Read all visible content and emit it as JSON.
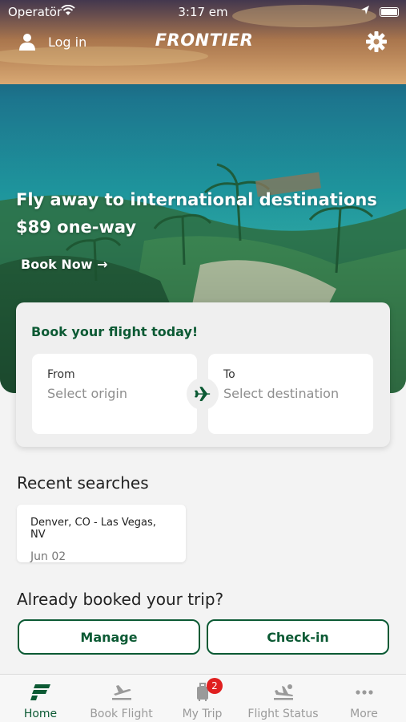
{
  "status_bar": {
    "carrier": "Operatör",
    "time": "3:17 em"
  },
  "header": {
    "login_label": "Log in",
    "brand": "FRONTIER"
  },
  "promo": {
    "line1": "Fly away to international destinations",
    "line2": "$89 one-way",
    "cta": "Book Now →"
  },
  "booking": {
    "title": "Book your flight today!",
    "from_label": "From",
    "from_placeholder": "Select origin",
    "to_label": "To",
    "to_placeholder": "Select destination"
  },
  "recent": {
    "title": "Recent searches",
    "items": [
      {
        "route": "Denver, CO - Las Vegas, NV",
        "date": "Jun 02"
      }
    ]
  },
  "booked": {
    "title": "Already booked your trip?",
    "manage_label": "Manage",
    "checkin_label": "Check-in"
  },
  "tabs": [
    {
      "label": "Home",
      "icon": "frontier-f-icon",
      "active": true
    },
    {
      "label": "Book Flight",
      "icon": "plane-takeoff-icon"
    },
    {
      "label": "My Trip",
      "icon": "luggage-icon",
      "badge": "2"
    },
    {
      "label": "Flight Status",
      "icon": "plane-landing-icon"
    },
    {
      "label": "More",
      "icon": "more-dots-icon"
    }
  ],
  "colors": {
    "brand_green": "#0c5a34",
    "badge_red": "#e02020",
    "inactive_gray": "#9a9a9a"
  }
}
